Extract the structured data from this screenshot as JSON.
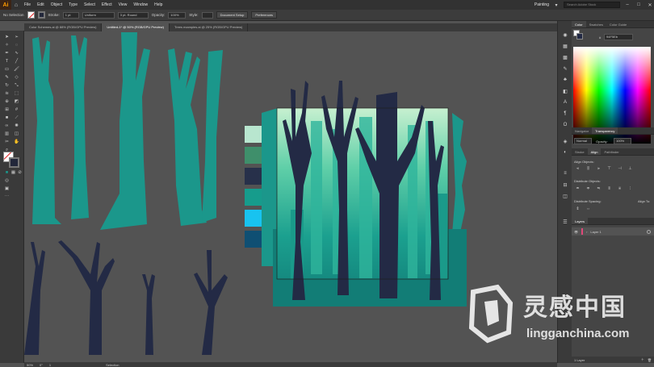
{
  "app": {
    "logo": "Ai",
    "workspace": "Painting",
    "search_placeholder": "Search Adobe Stock"
  },
  "menu": [
    "File",
    "Edit",
    "Object",
    "Type",
    "Select",
    "Effect",
    "View",
    "Window",
    "Help"
  ],
  "control": {
    "selection": "No Selection",
    "stroke_label": "Stroke:",
    "stroke_weight": "1 pt",
    "profile_label": "Uniform",
    "brush_label": "3 pt. Round",
    "opacity_label": "Opacity:",
    "opacity_value": "100%",
    "style_label": "Style:",
    "doc_setup": "Document Setup",
    "preferences": "Preferences"
  },
  "tabs": [
    "Color Schemes.ai @ 88% (RGB/GPU Preview)",
    "Untitled-1* @ 50% (RGB/GPU Preview)",
    "Trees examples.ai @ 25% (RGB/GPU Preview)"
  ],
  "active_tab": 1,
  "swatches": [
    "#b8e6cf",
    "#3f8f6b",
    "#27304a",
    "#169c8c",
    "#18c3f0",
    "#0f4f73"
  ],
  "colors": {
    "teal": "#1b978b",
    "navy": "#232a45",
    "art_bg": "#127d76"
  },
  "panels": {
    "color_tabs": [
      "Color",
      "Swatches",
      "Color Guide"
    ],
    "hex_value": "94F5Eb",
    "nav_tabs": [
      "Navigator",
      "Transparency"
    ],
    "blend_mode": "Normal",
    "opacity_label": "Opacity:",
    "opacity_value": "100%",
    "align_tabs": [
      "Stroke",
      "Align",
      "Pathfinder"
    ],
    "align_objects": "Align Objects:",
    "distribute_objects": "Distribute Objects:",
    "distribute_spacing": "Distribute Spacing:",
    "align_to": "Align To:",
    "layers_tab": "Layers",
    "layer_name": "Layer 1",
    "layers_count": "1 Layer"
  },
  "status": {
    "zoom": "50%",
    "angle": "0°",
    "page": "1",
    "tool": "Selection"
  },
  "watermark": {
    "title": "灵感中国",
    "url": "lingganchina.com"
  }
}
